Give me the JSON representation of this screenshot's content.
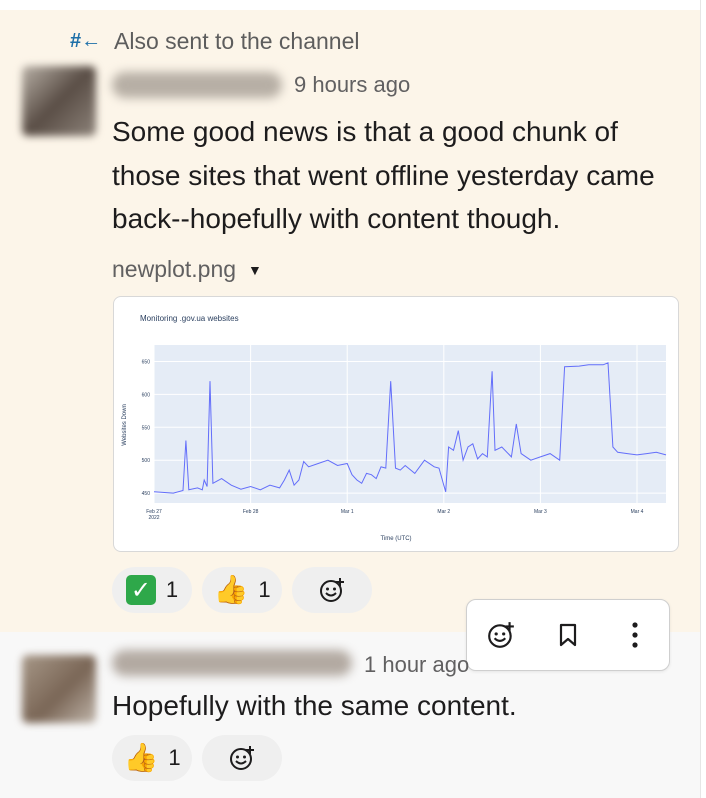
{
  "thread_banner": {
    "icon": "hash-back-arrow-icon",
    "text": "Also sent to the channel"
  },
  "message1": {
    "timestamp": "9 hours ago",
    "text": "Some good news is that a good chunk of those sites that went offline yesterday came back--hopefully with content though.",
    "attachment": {
      "filename": "newplot.png",
      "icon": "chevron-down-icon"
    },
    "reactions": [
      {
        "emoji": "white-check-mark",
        "glyph": "✓",
        "count": "1"
      },
      {
        "emoji": "thumbs-up",
        "glyph": "👍",
        "count": "1"
      }
    ]
  },
  "message2": {
    "timestamp": "1 hour ago",
    "text": "Hopefully with the same content.",
    "reactions": [
      {
        "emoji": "thumbs-up",
        "glyph": "👍",
        "count": "1"
      }
    ]
  },
  "hover_toolbar": {
    "icons": [
      "add-reaction-icon",
      "bookmark-icon",
      "more-actions-icon"
    ]
  },
  "colors": {
    "highlight_bg": "#fcf5e9",
    "plot_bg": "#e5ecf6",
    "line": "#636efa",
    "check_green": "#2ea84a"
  },
  "chart_data": {
    "type": "line",
    "title": "Monitoring .gov.ua websites",
    "xlabel": "Time (UTC)",
    "ylabel": "Websites Down",
    "x_ticks": [
      "Feb 27\n2022",
      "Feb 28",
      "Mar 1",
      "Mar 2",
      "Mar 3",
      "Mar 4"
    ],
    "y_ticks": [
      450,
      500,
      550,
      600,
      650
    ],
    "ylim": [
      435,
      675
    ],
    "x_range_days": [
      0,
      5.3
    ],
    "series": [
      {
        "points": [
          [
            0.0,
            452
          ],
          [
            0.2,
            450
          ],
          [
            0.3,
            454
          ],
          [
            0.33,
            530
          ],
          [
            0.36,
            455
          ],
          [
            0.45,
            458
          ],
          [
            0.5,
            455
          ],
          [
            0.52,
            470
          ],
          [
            0.55,
            460
          ],
          [
            0.58,
            620
          ],
          [
            0.61,
            465
          ],
          [
            0.7,
            472
          ],
          [
            0.8,
            462
          ],
          [
            0.9,
            456
          ],
          [
            1.0,
            460
          ],
          [
            1.1,
            455
          ],
          [
            1.2,
            462
          ],
          [
            1.3,
            458
          ],
          [
            1.35,
            470
          ],
          [
            1.4,
            485
          ],
          [
            1.45,
            462
          ],
          [
            1.5,
            470
          ],
          [
            1.55,
            498
          ],
          [
            1.6,
            490
          ],
          [
            1.7,
            495
          ],
          [
            1.8,
            500
          ],
          [
            1.9,
            492
          ],
          [
            2.0,
            495
          ],
          [
            2.05,
            478
          ],
          [
            2.1,
            470
          ],
          [
            2.15,
            465
          ],
          [
            2.2,
            480
          ],
          [
            2.25,
            478
          ],
          [
            2.3,
            472
          ],
          [
            2.35,
            490
          ],
          [
            2.4,
            488
          ],
          [
            2.45,
            620
          ],
          [
            2.5,
            488
          ],
          [
            2.55,
            485
          ],
          [
            2.6,
            492
          ],
          [
            2.7,
            480
          ],
          [
            2.8,
            500
          ],
          [
            2.9,
            490
          ],
          [
            2.95,
            488
          ],
          [
            3.0,
            462
          ],
          [
            3.02,
            452
          ],
          [
            3.05,
            520
          ],
          [
            3.1,
            515
          ],
          [
            3.15,
            545
          ],
          [
            3.2,
            500
          ],
          [
            3.25,
            520
          ],
          [
            3.3,
            525
          ],
          [
            3.35,
            502
          ],
          [
            3.4,
            510
          ],
          [
            3.45,
            505
          ],
          [
            3.5,
            635
          ],
          [
            3.53,
            515
          ],
          [
            3.6,
            520
          ],
          [
            3.7,
            505
          ],
          [
            3.75,
            555
          ],
          [
            3.8,
            510
          ],
          [
            3.9,
            500
          ],
          [
            4.0,
            505
          ],
          [
            4.1,
            510
          ],
          [
            4.2,
            500
          ],
          [
            4.25,
            642
          ],
          [
            4.4,
            643
          ],
          [
            4.5,
            645
          ],
          [
            4.65,
            645
          ],
          [
            4.7,
            648
          ],
          [
            4.75,
            520
          ],
          [
            4.8,
            512
          ],
          [
            4.9,
            510
          ],
          [
            5.0,
            508
          ],
          [
            5.1,
            510
          ],
          [
            5.2,
            512
          ],
          [
            5.3,
            508
          ]
        ]
      }
    ]
  }
}
